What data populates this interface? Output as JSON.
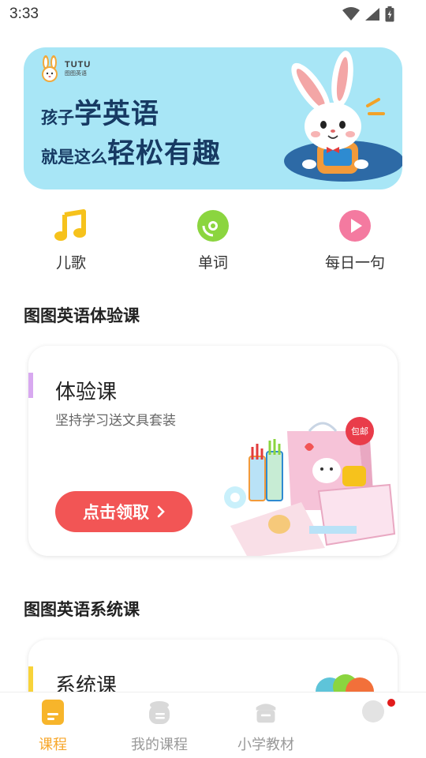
{
  "status_bar": {
    "time": "3:33"
  },
  "banner": {
    "logo_en": "TUTU",
    "logo_cn": "图图英语",
    "line1_small": "孩子",
    "line1_big": "学英语",
    "line2_small": "就是这么",
    "line2_big": "轻松有趣"
  },
  "quick_nav": [
    {
      "label": "儿歌",
      "icon": "music-note-icon",
      "color": "#f6c21c"
    },
    {
      "label": "单词",
      "icon": "disc-icon",
      "color": "#8bd53f"
    },
    {
      "label": "每日一句",
      "icon": "play-circle-icon",
      "color": "#f47aa0"
    }
  ],
  "trial_section": {
    "title": "图图英语体验课",
    "card_title": "体验课",
    "card_subtitle": "坚持学习送文具套装",
    "button_label": "点击领取",
    "badge": "包邮",
    "accent_color": "#d8a9f0"
  },
  "system_section": {
    "title": "图图英语系统课",
    "card_title": "系统课",
    "accent_color": "#f8d33a"
  },
  "bottom_nav": [
    {
      "label": "课程",
      "icon": "course-icon",
      "active": true
    },
    {
      "label": "我的课程",
      "icon": "my-course-icon",
      "active": false
    },
    {
      "label": "小学教材",
      "icon": "textbook-icon",
      "active": false
    },
    {
      "label": "",
      "icon": "profile-icon",
      "active": false,
      "badge": true
    }
  ],
  "colors": {
    "accent": "#f7a72b",
    "button": "#f25555",
    "banner_bg": "#a8e6f6",
    "banner_text": "#173a63"
  }
}
